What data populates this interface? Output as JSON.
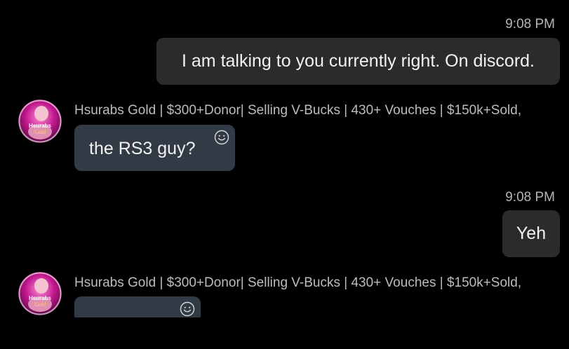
{
  "messages": [
    {
      "kind": "timestamp",
      "text": "9:08 PM"
    },
    {
      "kind": "outgoing",
      "text": "I am talking to you currently right. On discord."
    },
    {
      "kind": "incoming",
      "sender": "Hsurabs Gold | $300+Donor| Selling V-Bucks | 430+ Vouches | $150k+Sold,",
      "text": "the RS3 guy?",
      "avatar_caption": "Hsurabs Gold",
      "react_icon": "smiley-reaction-icon"
    },
    {
      "kind": "timestamp",
      "text": "9:08 PM"
    },
    {
      "kind": "outgoing",
      "text": "Yeh"
    },
    {
      "kind": "incoming",
      "sender": "Hsurabs Gold | $300+Donor| Selling V-Bucks | 430+ Vouches | $150k+Sold,",
      "text": "",
      "avatar_caption": "Hsurabs Gold",
      "react_icon": "smiley-reaction-icon"
    }
  ],
  "colors": {
    "background": "#000000",
    "outgoing_bubble": "#2b2b2b",
    "incoming_bubble": "#323a45",
    "avatar_pink": "#c2188f"
  }
}
